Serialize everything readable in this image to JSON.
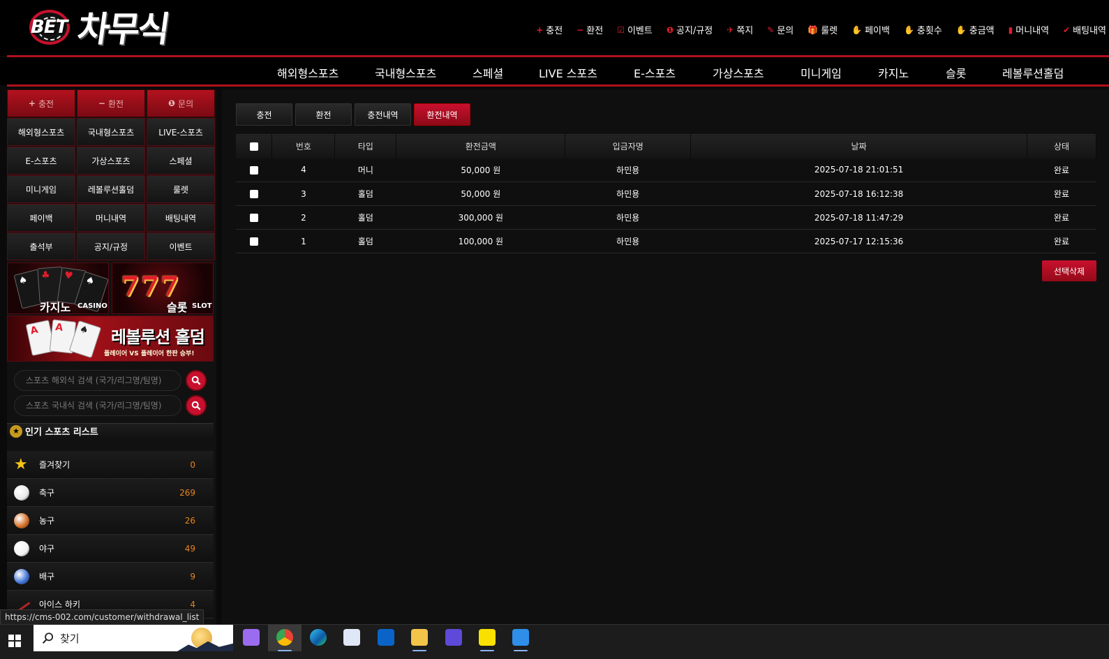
{
  "header": {
    "logo_small": "BET",
    "logo_brand": "차무식",
    "top_nav": [
      {
        "icon": "plus-icon",
        "glyph": "+",
        "label": "충전"
      },
      {
        "icon": "minus-icon",
        "glyph": "−",
        "label": "환전"
      },
      {
        "icon": "calendar-icon",
        "glyph": "☑",
        "label": "이벤트"
      },
      {
        "icon": "info-icon",
        "glyph": "❶",
        "label": "공지/규정"
      },
      {
        "icon": "send-icon",
        "glyph": "✈",
        "label": "쪽지"
      },
      {
        "icon": "edit-icon",
        "glyph": "✎",
        "label": "문의"
      },
      {
        "icon": "gift-icon",
        "glyph": "🎁",
        "label": "룰렛"
      },
      {
        "icon": "hand-coin-icon",
        "glyph": "✋",
        "label": "페이백"
      },
      {
        "icon": "hand-coin-icon",
        "glyph": "✋",
        "label": "충횟수"
      },
      {
        "icon": "hand-coin-icon",
        "glyph": "✋",
        "label": "충금액"
      },
      {
        "icon": "trash-icon",
        "glyph": "▮",
        "label": "머니내역"
      },
      {
        "icon": "check-icon",
        "glyph": "✔",
        "label": "배팅내역"
      }
    ],
    "main_nav": [
      "해외형스포츠",
      "국내형스포츠",
      "스페셜",
      "LIVE 스포츠",
      "E-스포츠",
      "가상스포츠",
      "미니게임",
      "카지노",
      "슬롯",
      "레볼루션홀덤"
    ]
  },
  "sidebar": {
    "quick_buttons": [
      {
        "icon": "plus-icon",
        "glyph": "+",
        "label": "충전"
      },
      {
        "icon": "minus-icon",
        "glyph": "−",
        "label": "환전"
      },
      {
        "icon": "info-icon",
        "glyph": "❶",
        "label": "문의"
      }
    ],
    "menu": [
      "해외형스포츠",
      "국내형스포츠",
      "LIVE-스포츠",
      "E-스포츠",
      "가상스포츠",
      "스페셜",
      "미니게임",
      "레볼루션홀덤",
      "룰렛",
      "페이백",
      "머니내역",
      "배팅내역",
      "출석부",
      "공지/규정",
      "이벤트"
    ],
    "banners": {
      "casino": {
        "title": "카지노",
        "sub": "CASINO"
      },
      "slot": {
        "title": "슬롯",
        "sub": "SLOT",
        "sevens": "777"
      },
      "holdem": {
        "title": "레볼루션 홀덤",
        "sub": "플레이어 VS 플레이어 한판 승부!"
      }
    },
    "search_overseas_placeholder": "스포츠 해외식 검색 (국가/리그명/팀명)",
    "search_domestic_placeholder": "스포츠 국내식 검색 (국가/리그명/팀명)",
    "popular_title": "인기 스포츠 리스트",
    "sports": [
      {
        "name": "즐겨찾기",
        "count": "0",
        "icon": "star-icon",
        "color": "#f5c518"
      },
      {
        "name": "축구",
        "count": "269",
        "icon": "soccer-ball-icon",
        "color": "#e8e8e8"
      },
      {
        "name": "농구",
        "count": "26",
        "icon": "basketball-icon",
        "color": "#d2691e"
      },
      {
        "name": "야구",
        "count": "49",
        "icon": "baseball-icon",
        "color": "#f2f2f2"
      },
      {
        "name": "배구",
        "count": "9",
        "icon": "volleyball-icon",
        "color": "#3b6fd4"
      },
      {
        "name": "아이스 하키",
        "count": "4",
        "icon": "hockey-stick-icon",
        "color": "#b22222"
      }
    ]
  },
  "main": {
    "tabs": [
      {
        "label": "충전",
        "active": false
      },
      {
        "label": "환전",
        "active": false
      },
      {
        "label": "충전내역",
        "active": false
      },
      {
        "label": "환전내역",
        "active": true
      }
    ],
    "columns": [
      "번호",
      "타입",
      "환전금액",
      "입금자명",
      "날짜",
      "상태"
    ],
    "rows": [
      {
        "no": "4",
        "type": "머니",
        "amount": "50,000 원",
        "name": "하민용",
        "date": "2025-07-18 21:01:51",
        "status": "완료"
      },
      {
        "no": "3",
        "type": "홀덤",
        "amount": "50,000 원",
        "name": "하민용",
        "date": "2025-07-18 16:12:38",
        "status": "완료"
      },
      {
        "no": "2",
        "type": "홀덤",
        "amount": "300,000 원",
        "name": "하민용",
        "date": "2025-07-18 11:47:29",
        "status": "완료"
      },
      {
        "no": "1",
        "type": "홀덤",
        "amount": "100,000 원",
        "name": "하민용",
        "date": "2025-07-17 12:15:36",
        "status": "완료"
      }
    ],
    "delete_label": "선택삭제"
  },
  "status_url": "https://cms-002.com/customer/withdrawal_list",
  "taskbar": {
    "search_label": "찾기",
    "apps": [
      {
        "name": "copilot-icon",
        "color": "#9b6cf0"
      },
      {
        "name": "chrome-icon",
        "color": "#34a853"
      },
      {
        "name": "edge-icon",
        "color": "#1e90ff"
      },
      {
        "name": "app-icon",
        "color": "#dfe6f5"
      },
      {
        "name": "outlook-icon",
        "color": "#0a64c8"
      },
      {
        "name": "file-explorer-icon",
        "color": "#f2c44a"
      },
      {
        "name": "opgg-icon",
        "color": "#5d4ad8"
      },
      {
        "name": "kakaotalk-icon",
        "color": "#f9e000"
      },
      {
        "name": "photos-icon",
        "color": "#2f8fe8"
      }
    ]
  },
  "colors": {
    "accent": "#c8102e",
    "count": "#e8851e",
    "background": "#0a0a0a"
  }
}
